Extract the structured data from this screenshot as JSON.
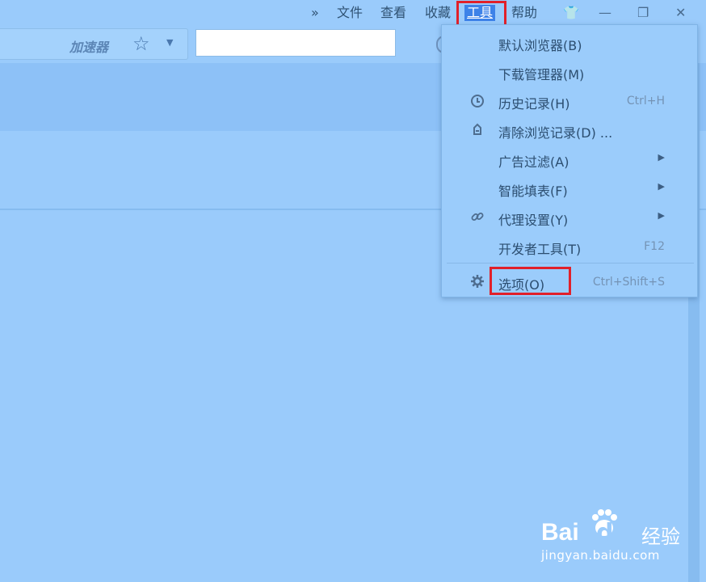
{
  "menubar": {
    "overflow": "»",
    "file": "文件",
    "view": "查看",
    "favorites": "收藏",
    "tools": "工具",
    "help": "帮助"
  },
  "window_controls": {
    "skin": "👕",
    "minimize": "—",
    "restore": "❐",
    "close": "✕"
  },
  "toolbar": {
    "accelerator": "加速器",
    "star": "☆",
    "caret": "▼",
    "search_value": ""
  },
  "tools_menu": {
    "items": [
      {
        "label": "默认浏览器(B)",
        "shortcut": "",
        "icon": "",
        "submenu": false
      },
      {
        "label": "下载管理器(M)",
        "shortcut": "",
        "icon": "",
        "submenu": false
      },
      {
        "label": "历史记录(H)",
        "shortcut": "Ctrl+H",
        "icon": "clock-icon",
        "submenu": false
      },
      {
        "label": "清除浏览记录(D) ...",
        "shortcut": "",
        "icon": "eraser-icon",
        "submenu": false
      },
      {
        "label": "广告过滤(A)",
        "shortcut": "",
        "icon": "",
        "submenu": true
      },
      {
        "label": "智能填表(F)",
        "shortcut": "",
        "icon": "",
        "submenu": true
      },
      {
        "label": "代理设置(Y)",
        "shortcut": "",
        "icon": "link-icon",
        "submenu": true
      },
      {
        "label": "开发者工具(T)",
        "shortcut": "F12",
        "icon": "",
        "submenu": false
      },
      {
        "label": "选项(O)",
        "shortcut": "Ctrl+Shift+S",
        "icon": "gear-icon",
        "submenu": false
      }
    ],
    "submenu_arrow": "▶"
  },
  "watermark": {
    "brand_left": "Bai",
    "brand_right": "du",
    "product": "经验",
    "url": "jingyan.baidu.com"
  },
  "colors": {
    "background": "#9acbfb",
    "highlight_box": "#e1202a",
    "active_menu": "#3d82e8"
  }
}
